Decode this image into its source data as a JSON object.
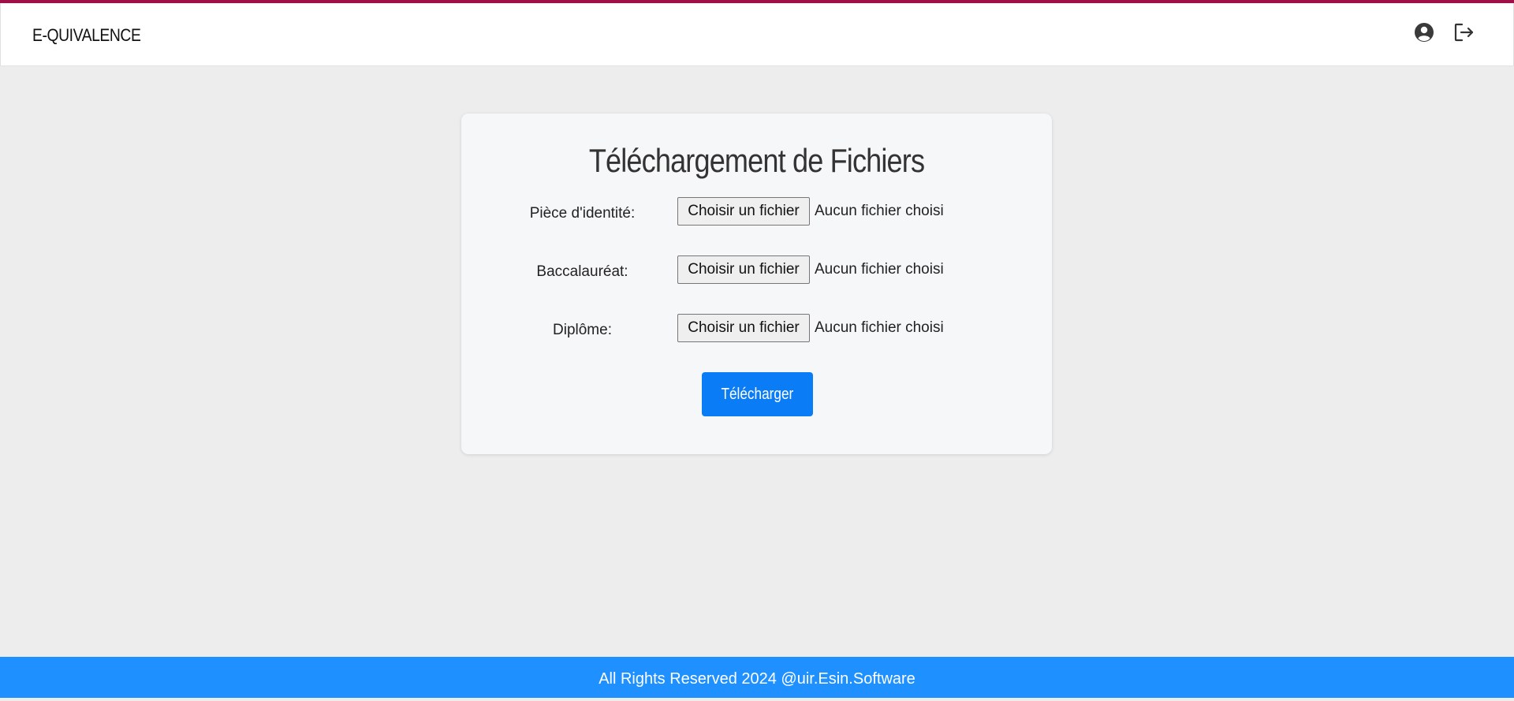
{
  "header": {
    "brand": "E-QUIVALENCE",
    "icons": [
      "user-circle-icon",
      "logout-icon"
    ],
    "accent_color": "#a01048"
  },
  "upload": {
    "title": "Téléchargement de Fichiers",
    "fields": [
      {
        "label": "Pièce d'identité:",
        "button": "Choisir un fichier",
        "status": "Aucun fichier choisi"
      },
      {
        "label": "Baccalauréat:",
        "button": "Choisir un fichier",
        "status": "Aucun fichier choisi"
      },
      {
        "label": "Diplôme:",
        "button": "Choisir un fichier",
        "status": "Aucun fichier choisi"
      }
    ],
    "submit_label": "Télécharger",
    "submit_color": "#0a7cf6"
  },
  "footer": {
    "text": "All Rights Reserved 2024 @uir.Esin.Software",
    "color": "#1e90ff"
  }
}
